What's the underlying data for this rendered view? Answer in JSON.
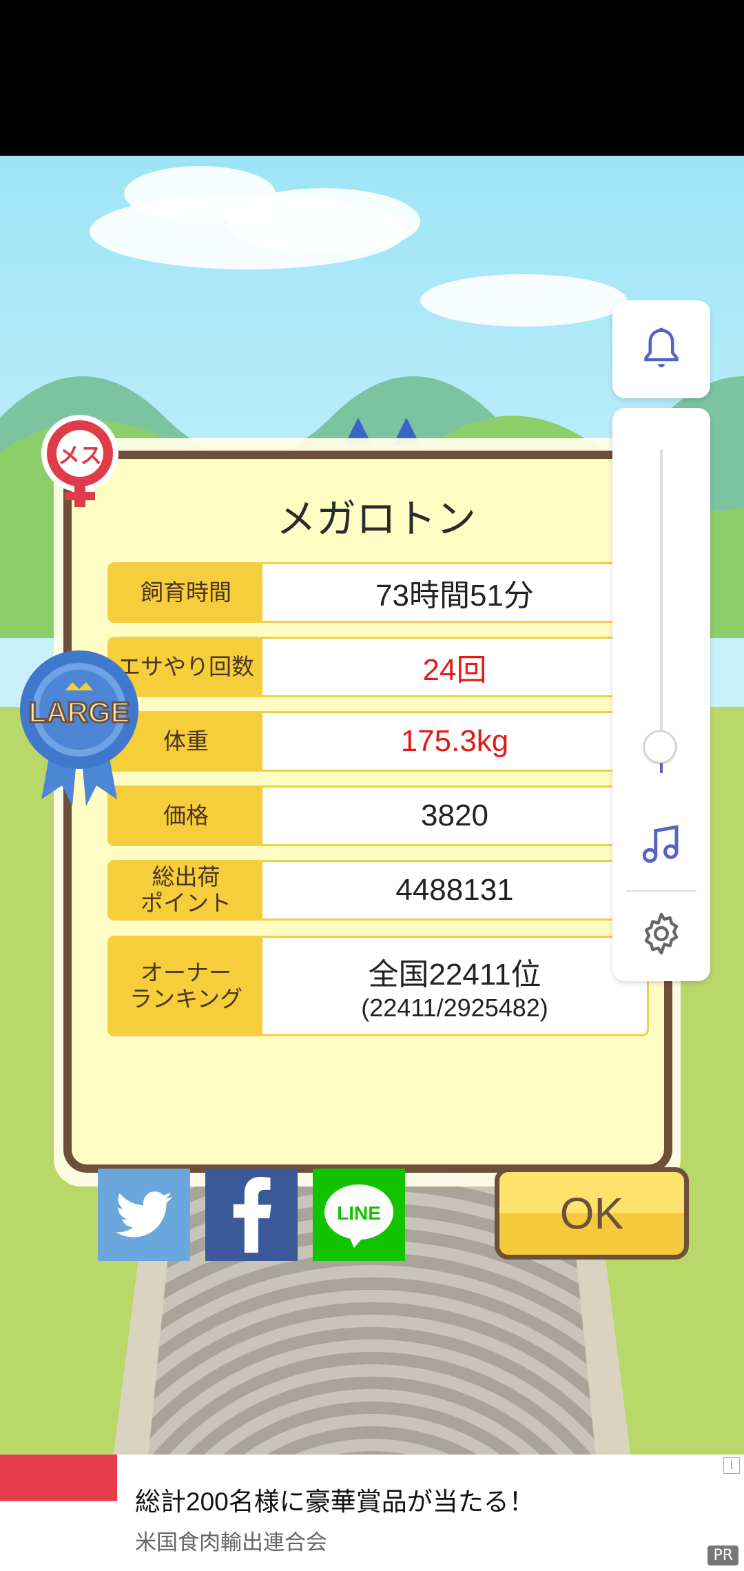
{
  "dialog": {
    "title": "メガロトン",
    "rows": [
      {
        "label": "飼育時間",
        "value": "73時間51分"
      },
      {
        "label": "エサやり回数",
        "value": "24回"
      },
      {
        "label": "体重",
        "value": "175.3kg"
      },
      {
        "label": "価格",
        "value": "3820"
      },
      {
        "label": "総出荷\nポイント",
        "value": "4488131"
      },
      {
        "label": "オーナー\nランキング",
        "value": "全国22411位",
        "value_sub": "(22411/2925482)"
      }
    ],
    "ok_label": "OK",
    "share_line_label": "LINE",
    "badge_large": "LARGE",
    "gender_label": "メス"
  },
  "ad": {
    "title": "総計200名様に豪華賞品が当たる！",
    "advertiser": "米国食肉輸出連合会",
    "pr_label": "PR",
    "info_label": "i"
  },
  "volume": {
    "level": 0.08
  },
  "colors": {
    "accent": "#5563c1",
    "gold": "#f6cd3a",
    "frame": "#6d4f3a",
    "highlight_red": "#e31a1a"
  }
}
